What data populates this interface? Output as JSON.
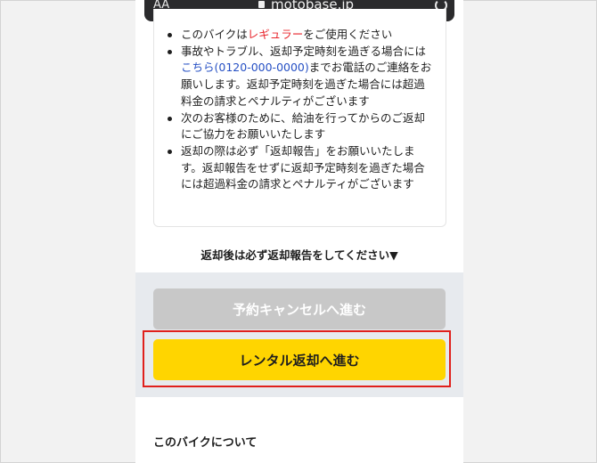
{
  "browser": {
    "aa_label": "AA",
    "domain": "motobase.jp"
  },
  "notice": {
    "items": [
      {
        "pre": "このバイクは",
        "accent": "レギュラー",
        "post": "をご使用ください"
      },
      {
        "pre": "事故やトラブル、返却予定時刻を過ぎる場合にはこちら",
        "link": "こちら(0120-000-0000)",
        "line1": "事故やトラブル、返却予定時刻を過ぎる場合には",
        "post": "までお電話のご連絡をお願いします。返却予定時刻を過ぎた場合には超過料金の請求とペナルティがございます"
      },
      {
        "text": "次のお客様のために、給油を行ってからのご返却にご協力をお願いいたします"
      },
      {
        "text": "返却の際は必ず「返却報告」をお願いいたします。返却報告をせずに返却予定時刻を過ぎた場合には超過料金の請求とペナルティがございます"
      }
    ]
  },
  "return_note": "返却後は必ず返却報告をしてください▼",
  "buttons": {
    "cancel": "予約キャンセルへ進む",
    "return": "レンタル返却へ進む"
  },
  "about": {
    "title": "このバイクについて"
  }
}
